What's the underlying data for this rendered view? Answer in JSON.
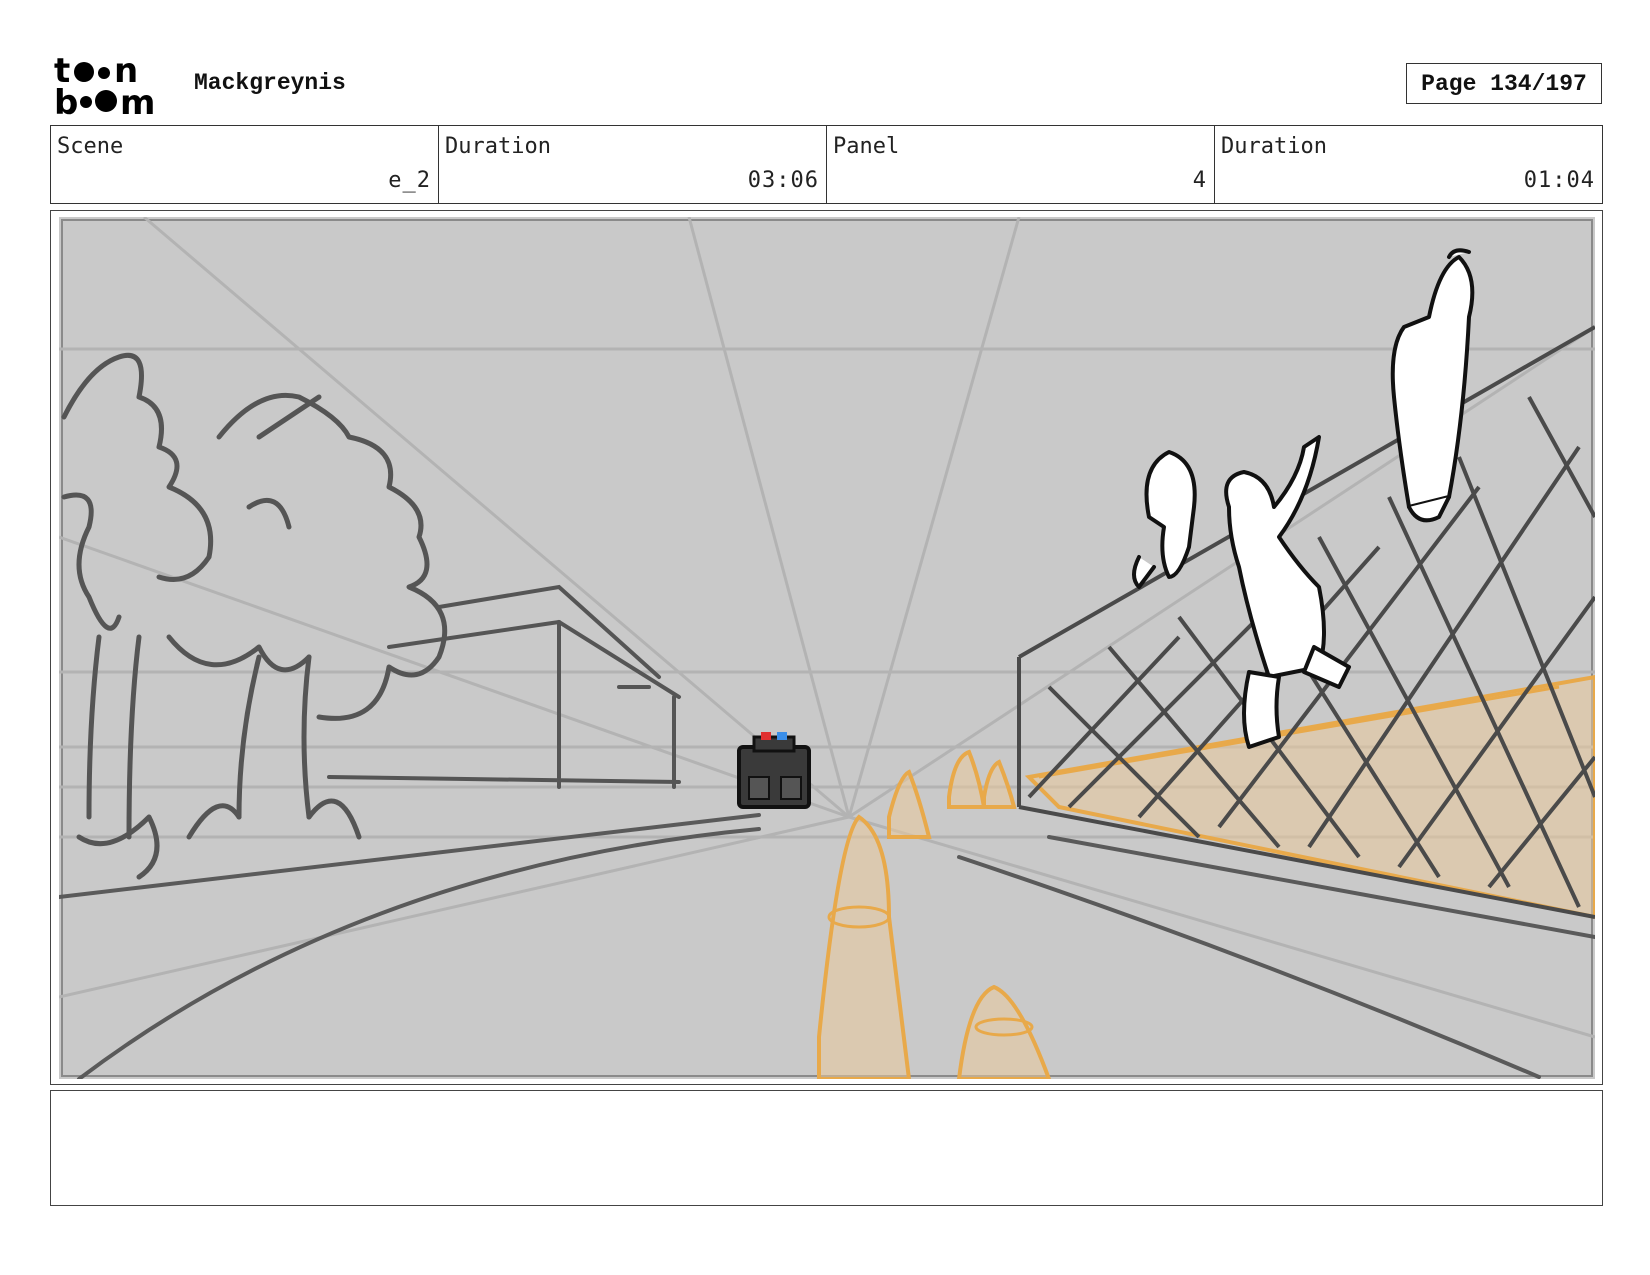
{
  "header": {
    "logo_icon": "toon-boom-logo",
    "logo_lines": [
      "t●●n",
      "b●●m"
    ],
    "project_title": "Mackgreynis",
    "page_label": "Page 134/197"
  },
  "info": {
    "scene_label": "Scene",
    "scene_value": "e_2",
    "duration_label": "Duration",
    "duration_value": "03:06",
    "panel_label": "Panel",
    "panel_value": "4",
    "panel_duration_label": "Duration",
    "panel_duration_value": "01:04"
  },
  "panel": {
    "art_icon": "storyboard-sketch",
    "background_color": "#c9c9c9",
    "line_color": "#555555",
    "cone_color": "#e8a94a",
    "police_lights": [
      "#e03030",
      "#3a8ee8"
    ]
  },
  "notes": {
    "text": ""
  }
}
